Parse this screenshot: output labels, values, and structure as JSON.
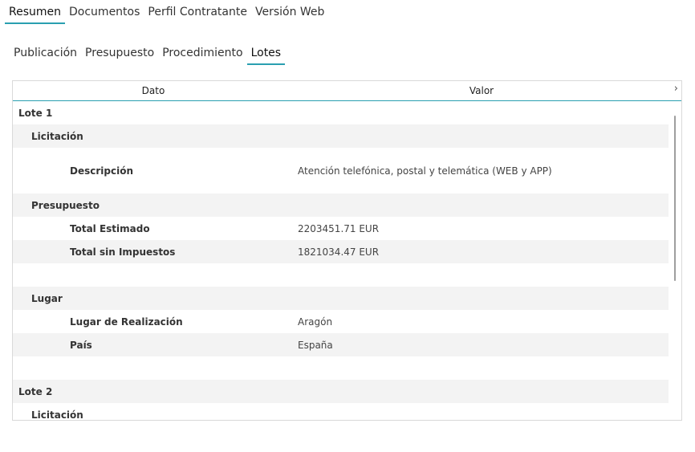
{
  "main_tabs": [
    {
      "label": "Resumen",
      "active": true
    },
    {
      "label": "Documentos",
      "active": false
    },
    {
      "label": "Perfil Contratante",
      "active": false
    },
    {
      "label": "Versión Web",
      "active": false
    }
  ],
  "sub_tabs": [
    {
      "label": "Publicación",
      "active": false
    },
    {
      "label": "Presupuesto",
      "active": false
    },
    {
      "label": "Procedimiento",
      "active": false
    },
    {
      "label": "Lotes",
      "active": true
    }
  ],
  "grid": {
    "header_dato": "Dato",
    "header_valor": "Valor",
    "expand_icon": "chevron-right",
    "rows": [
      {
        "level": 0,
        "dato": "Lote 1",
        "valor": "",
        "alt": false
      },
      {
        "level": 1,
        "dato": "Licitación",
        "valor": "",
        "alt": true
      },
      {
        "level": 2,
        "dato": "Descripción",
        "valor": "Atención telefónica, postal y telemática (WEB y APP)",
        "alt": false,
        "tall": true
      },
      {
        "level": 1,
        "dato": "Presupuesto",
        "valor": "",
        "alt": true
      },
      {
        "level": 2,
        "dato": "Total Estimado",
        "valor": "2203451.71 EUR",
        "alt": false
      },
      {
        "level": 2,
        "dato": "Total sin Impuestos",
        "valor": "1821034.47 EUR",
        "alt": true
      },
      {
        "level": 2,
        "dato": "",
        "valor": "",
        "alt": false
      },
      {
        "level": 1,
        "dato": "Lugar",
        "valor": "",
        "alt": true
      },
      {
        "level": 2,
        "dato": "Lugar de Realización",
        "valor": "Aragón",
        "alt": false
      },
      {
        "level": 2,
        "dato": "País",
        "valor": "España",
        "alt": true
      },
      {
        "level": 2,
        "dato": "",
        "valor": "",
        "alt": false
      },
      {
        "level": 0,
        "dato": "Lote 2",
        "valor": "",
        "alt": true
      },
      {
        "level": 1,
        "dato": "Licitación",
        "valor": "",
        "alt": false
      }
    ]
  }
}
